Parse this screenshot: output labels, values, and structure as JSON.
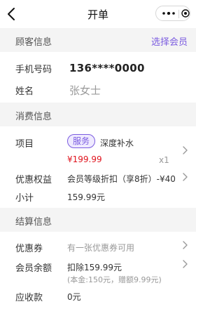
{
  "nav": {
    "title": "开单",
    "back_icon": "chevron-left-icon",
    "more_icon": "more-dots-icon",
    "close_icon": "target-circle-icon"
  },
  "customer": {
    "section_title": "顾客信息",
    "select_member": "选择会员",
    "phone_label": "手机号码",
    "phone_value": "136****0000",
    "name_label": "姓名",
    "name_placeholder": "张女士"
  },
  "consumption": {
    "section_title": "消费信息",
    "item_label": "项目",
    "service_badge": "服务",
    "service_name": "深度补水",
    "price": "¥199.99",
    "quantity": "x1",
    "discount_label": "优惠权益",
    "discount_value": "会员等级折扣（享8折）-¥40",
    "subtotal_label": "小计",
    "subtotal_value": "159.99元"
  },
  "settlement": {
    "section_title": "结算信息",
    "coupon_label": "优惠券",
    "coupon_value": "有一张优惠券可用",
    "balance_label": "会员余额",
    "balance_value": "扣除159.99元",
    "balance_detail": "(本金:150元，赠额9.99元)",
    "receivable_label": "应收款",
    "receivable_value": "0元"
  },
  "colors": {
    "accent": "#7b5ce0",
    "price": "#e0141e",
    "section_bg": "#f4f4f4"
  }
}
